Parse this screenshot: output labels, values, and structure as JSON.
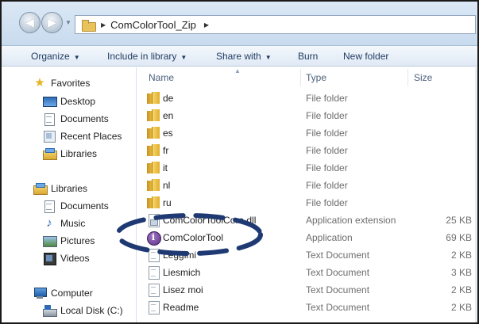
{
  "window": {
    "breadcrumb_current": "ComColorTool_Zip"
  },
  "toolbar": {
    "organize": "Organize",
    "include": "Include in library",
    "share": "Share with",
    "burn": "Burn",
    "new_folder": "New folder"
  },
  "sidebar": {
    "favorites": "Favorites",
    "desktop": "Desktop",
    "documents": "Documents",
    "recent_places": "Recent Places",
    "libraries_fav": "Libraries",
    "libraries": "Libraries",
    "lib_documents": "Documents",
    "music": "Music",
    "pictures": "Pictures",
    "videos": "Videos",
    "computer": "Computer",
    "local_disk": "Local Disk (C:)"
  },
  "columns": {
    "name": "Name",
    "type": "Type",
    "size": "Size"
  },
  "files": [
    {
      "name": "de",
      "type": "File folder",
      "size": "",
      "icon": "folder-icon"
    },
    {
      "name": "en",
      "type": "File folder",
      "size": "",
      "icon": "folder-icon"
    },
    {
      "name": "es",
      "type": "File folder",
      "size": "",
      "icon": "folder-icon"
    },
    {
      "name": "fr",
      "type": "File folder",
      "size": "",
      "icon": "folder-icon"
    },
    {
      "name": "it",
      "type": "File folder",
      "size": "",
      "icon": "folder-icon"
    },
    {
      "name": "nl",
      "type": "File folder",
      "size": "",
      "icon": "folder-icon"
    },
    {
      "name": "ru",
      "type": "File folder",
      "size": "",
      "icon": "folder-icon"
    },
    {
      "name": "ComColorToolCore.dll",
      "type": "Application extension",
      "size": "25 KB",
      "icon": "dll-icon"
    },
    {
      "name": "ComColorTool",
      "type": "Application",
      "size": "69 KB",
      "icon": "app-icon"
    },
    {
      "name": "Leggimi",
      "type": "Text Document",
      "size": "2 KB",
      "icon": "txt-icon"
    },
    {
      "name": "Liesmich",
      "type": "Text Document",
      "size": "3 KB",
      "icon": "txt-icon"
    },
    {
      "name": "Lisez moi",
      "type": "Text Document",
      "size": "2 KB",
      "icon": "txt-icon"
    },
    {
      "name": "Readme",
      "type": "Text Document",
      "size": "2 KB",
      "icon": "txt-icon"
    }
  ],
  "colors": {
    "highlight_stroke": "#1f3a73"
  }
}
